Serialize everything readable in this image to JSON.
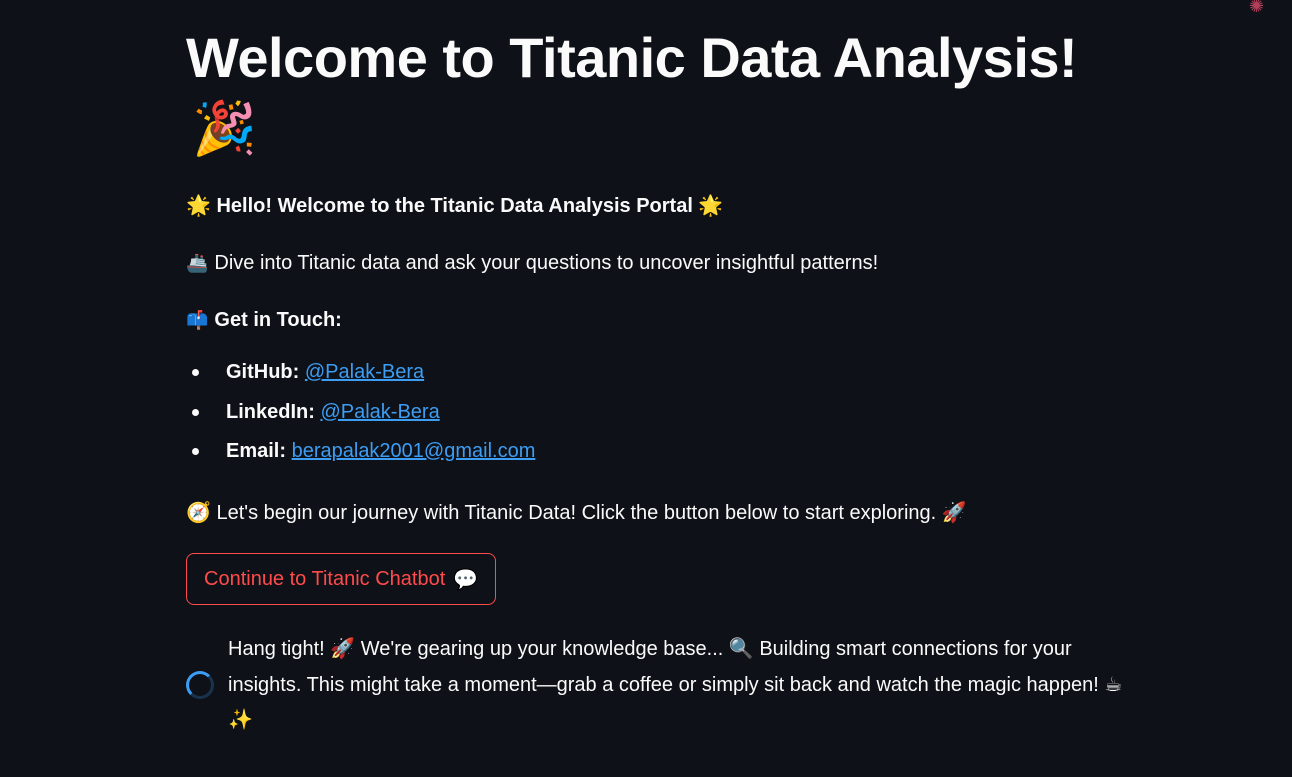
{
  "header": {
    "title": "Welcome to Titanic Data Analysis!",
    "title_emoji": "🎉",
    "corner_icon": "✺"
  },
  "intro": {
    "hello": "🌟 Hello! Welcome to the Titanic Data Analysis Portal 🌟",
    "dive_emoji": "🚢",
    "dive_text": "Dive into Titanic data and ask your questions to uncover insightful patterns!",
    "contact_emoji": "📫",
    "contact_heading": "Get in Touch:"
  },
  "contacts": [
    {
      "label": "GitHub:",
      "link": "@Palak-Bera"
    },
    {
      "label": "LinkedIn:",
      "link": "@Palak-Bera"
    },
    {
      "label": "Email:",
      "link": "berapalak2001@gmail.com"
    }
  ],
  "journey": {
    "text": "🧭 Let's begin our journey with Titanic Data! Click the button below to start exploring. 🚀"
  },
  "button": {
    "label": "Continue to Titanic Chatbot",
    "icon": "💬"
  },
  "status": {
    "message": "Hang tight! 🚀 We're gearing up your knowledge base... 🔍 Building smart connections for your insights. This might take a moment—grab a coffee or simply sit back and watch the magic happen! ☕ ✨"
  },
  "colors": {
    "background": "#0e1117",
    "text": "#fafafa",
    "link": "#3d9df3",
    "accent": "#ff4b4b"
  }
}
